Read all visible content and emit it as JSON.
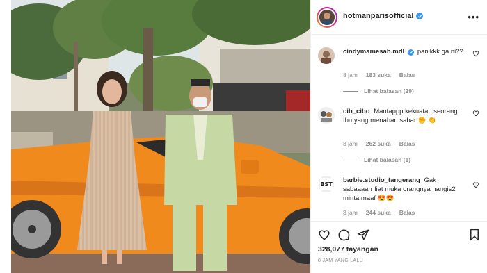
{
  "post": {
    "author": "hotmanparisofficial",
    "verified": true,
    "more_label": "•••"
  },
  "comments": [
    {
      "username": "cindymamesah.mdl",
      "verified": true,
      "text": "panikkk ga ni??",
      "time": "8 jam",
      "likes": "183 suka",
      "reply_label": "Balas",
      "view_replies": "Lihat balasan (29)"
    },
    {
      "username": "cib_cibo",
      "verified": false,
      "text": "Mantappp kekuatan seorang Ibu yang menahan sabar ✊ 👏",
      "time": "8 jam",
      "likes": "262 suka",
      "reply_label": "Balas",
      "view_replies": "Lihat balasan (1)"
    },
    {
      "username": "barbie.studio_tangerang",
      "verified": false,
      "text": "Gak sabaaaarr liat muka orangnya nangis2 minta maaf 😍😍",
      "time": "8 jam",
      "likes": "244 suka",
      "reply_label": "Balas"
    }
  ],
  "stats": {
    "views": "328,077 tayangan",
    "posted": "8 JAM YANG LALU"
  },
  "icons": {
    "like": "heart-icon",
    "comment": "comment-icon",
    "share": "send-icon",
    "save": "bookmark-icon",
    "verified": "verified-badge-icon",
    "more": "more-options-icon"
  },
  "colors": {
    "verified_blue": "#3897f0",
    "muted_text": "#8e8e8e",
    "car_orange": "#f08a1c"
  }
}
